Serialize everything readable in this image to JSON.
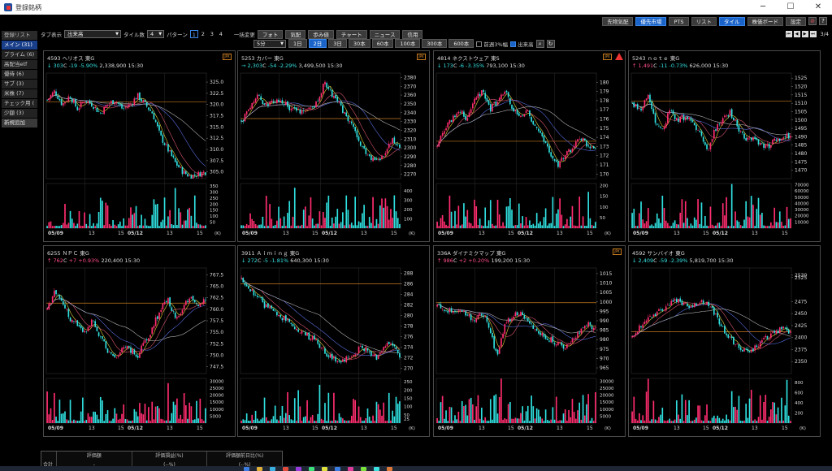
{
  "window": {
    "title": "登録銘柄",
    "min": "─",
    "max": "☐",
    "close": "✕"
  },
  "topbar": {
    "buttons": [
      {
        "label": "先物気配",
        "active": false
      },
      {
        "label": "優先市場",
        "active": true
      },
      {
        "label": "PTS",
        "active": false
      },
      {
        "label": "リスト",
        "active": false
      },
      {
        "label": "タイル",
        "active": true
      },
      {
        "label": "株価ボード",
        "active": false
      },
      {
        "label": "設定",
        "active": false
      }
    ],
    "icons": [
      {
        "name": "pin-icon",
        "glyph": "⊘",
        "color": "#e0505e"
      },
      {
        "name": "help-icon",
        "glyph": "?",
        "color": "#eeeeee"
      }
    ]
  },
  "sidebar": {
    "items": [
      {
        "label": "登録リスト",
        "kind": "header"
      },
      {
        "label": "メイン (31)",
        "kind": "active"
      },
      {
        "label": "プライム (6)",
        "kind": ""
      },
      {
        "label": "高配当etf",
        "kind": ""
      },
      {
        "label": "優待 (6)",
        "kind": ""
      },
      {
        "label": "サブ (3)",
        "kind": ""
      },
      {
        "label": "米株 (7)",
        "kind": ""
      },
      {
        "label": "チェック用 (",
        "kind": ""
      },
      {
        "label": "少額 (3)",
        "kind": ""
      },
      {
        "label": "新規追加",
        "kind": "add"
      }
    ]
  },
  "toolbar": {
    "tab_label": "タブ表示",
    "tab_value": "出来高",
    "tile_label": "タイル数",
    "tile_value": "4",
    "pattern_label": "パターン",
    "patterns": [
      "1",
      "2",
      "3",
      "4"
    ],
    "pattern_active": "1",
    "bulk_label": "一括変更",
    "buttons": [
      "フォト",
      "気配",
      "歩み値",
      "チャート",
      "ニュース",
      "信用"
    ],
    "interval_value": "5分",
    "spans": [
      "1日",
      "2日",
      "3日",
      "30本",
      "60本",
      "100本",
      "300本",
      "600本"
    ],
    "span_active": "2日",
    "opt1": "前週3%幅",
    "opt2": "出来高"
  },
  "pager": {
    "text": "3/4"
  },
  "colors": {
    "up": "#ff2d6f",
    "down": "#30e0e0",
    "ma1": "#e6d23a",
    "ma2": "#d8566f",
    "ma3": "#5a6ee0",
    "ma4": "#b2b2b2",
    "ref": "#c87b1e"
  },
  "tiles": [
    {
      "code": "4593",
      "name": "ヘリオス",
      "market": "東G",
      "arrow": "↓",
      "dir": "dn",
      "price": "303",
      "cflag": "C",
      "change": "-19",
      "pct": "-5.90%",
      "vol": "2,338,900",
      "time": "15:30",
      "badge": "JPX",
      "warn": false,
      "y_ticks": [
        "325.0",
        "322.5",
        "320.0",
        "317.5",
        "315.0",
        "312.5",
        "310.0",
        "307.5",
        "305.0"
      ],
      "v_ticks": [
        "350",
        "300",
        "250",
        "200",
        "150",
        "100",
        "50"
      ],
      "x_labels": [
        "05/09",
        "13",
        "15",
        "05/12",
        "13",
        "15"
      ],
      "vol_unit": "(K)",
      "chart_data": {
        "type": "candlestick",
        "ylim": [
          303.5,
          327
        ],
        "vmax": 370,
        "path": [
          321,
          323,
          320,
          322,
          319,
          321,
          320,
          318,
          320,
          321,
          319,
          320,
          322,
          320,
          318,
          313,
          310,
          307,
          305,
          304,
          304.5,
          305
        ]
      }
    },
    {
      "code": "5253",
      "name": "カバー",
      "market": "東G",
      "arrow": "→",
      "dir": "dn",
      "price": "2,303",
      "cflag": "C",
      "change": "-54",
      "pct": "-2.29%",
      "vol": "3,499,500",
      "time": "15:30",
      "badge": "JPX",
      "warn": false,
      "y_ticks": [
        "2380",
        "2370",
        "2360",
        "2350",
        "2340",
        "2330",
        "2320",
        "2310",
        "2300",
        "2290",
        "2280",
        "2270"
      ],
      "v_ticks": [
        "400",
        "300",
        "200",
        "100"
      ],
      "x_labels": [
        "05/09",
        "13",
        "15",
        "05/12",
        "13",
        "15"
      ],
      "vol_unit": "(K)",
      "chart_data": {
        "type": "candlestick",
        "ylim": [
          2265,
          2385
        ],
        "vmax": 480,
        "path": [
          2330,
          2345,
          2360,
          2352,
          2350,
          2355,
          2348,
          2343,
          2340,
          2347,
          2350,
          2375,
          2360,
          2350,
          2335,
          2320,
          2300,
          2290,
          2285,
          2295,
          2310,
          2303
        ]
      }
    },
    {
      "code": "4814",
      "name": "ネクストウェア",
      "market": "東S",
      "arrow": "↓",
      "dir": "dn",
      "price": "173",
      "cflag": "C",
      "change": "-6",
      "pct": "-3.35%",
      "vol": "793,100",
      "time": "15:30",
      "badge": "JPX",
      "warn": true,
      "y_ticks": [
        "180",
        "179",
        "178",
        "177",
        "176",
        "175",
        "174",
        "173",
        "172",
        "171",
        "170"
      ],
      "v_ticks": [
        "200",
        "150",
        "100",
        "50"
      ],
      "x_labels": [
        "05/09",
        "13",
        "15",
        "05/12",
        "13",
        "15"
      ],
      "vol_unit": "(K)",
      "chart_data": {
        "type": "candlestick",
        "ylim": [
          169.5,
          181
        ],
        "vmax": 210,
        "path": [
          173,
          175,
          176,
          177,
          176,
          178,
          179,
          177,
          178,
          179,
          177,
          176,
          177,
          175,
          174,
          172,
          171,
          172,
          173,
          174,
          173,
          173
        ]
      }
    },
    {
      "code": "5243",
      "name": "ｎｏｔｅ",
      "market": "東G",
      "arrow": "↑",
      "dir": "up",
      "price": "1,491",
      "cflag": "C",
      "change": "-11",
      "pct": "-0.73%",
      "vol": "626,000",
      "time": "15:30",
      "badge": "",
      "warn": false,
      "y_ticks": [
        "1525",
        "1520",
        "1515",
        "1510",
        "1505",
        "1500",
        "1495",
        "1490",
        "1485",
        "1480",
        "1475",
        "1470"
      ],
      "v_ticks": [
        "70000",
        "60000",
        "50000",
        "40000",
        "30000",
        "20000",
        "10000"
      ],
      "x_labels": [
        "05/09",
        "13",
        "15",
        "05/12",
        "13",
        "15"
      ],
      "vol_unit": "",
      "chart_data": {
        "type": "candlestick",
        "ylim": [
          1465,
          1528
        ],
        "vmax": 72000,
        "path": [
          1510,
          1505,
          1515,
          1500,
          1495,
          1505,
          1500,
          1502,
          1498,
          1492,
          1480,
          1495,
          1500,
          1505,
          1495,
          1488,
          1490,
          1486,
          1484,
          1488,
          1490,
          1491
        ]
      }
    },
    {
      "code": "6255",
      "name": "ＮＰＣ",
      "market": "東G",
      "arrow": "↑",
      "dir": "up",
      "price": "762",
      "cflag": "C",
      "change": "+7",
      "pct": "+0.93%",
      "vol": "220,400",
      "time": "15:30",
      "badge": "",
      "warn": false,
      "y_ticks": [
        "767.5",
        "765.0",
        "762.5",
        "760.0",
        "757.5",
        "755.0",
        "752.5",
        "750.0",
        "747.5"
      ],
      "v_ticks": [
        "30000",
        "25000",
        "20000",
        "15000",
        "10000",
        "5000"
      ],
      "x_labels": [
        "05/09",
        "13",
        "15",
        "05/12",
        "13",
        "15"
      ],
      "vol_unit": "",
      "chart_data": {
        "type": "candlestick",
        "ylim": [
          746,
          769
        ],
        "vmax": 32000,
        "path": [
          760,
          764,
          762,
          758,
          757,
          755,
          758,
          754,
          751,
          749,
          752,
          751,
          750,
          753,
          756,
          760,
          762,
          758,
          760,
          763,
          761,
          762
        ]
      }
    },
    {
      "code": "3911",
      "name": "Ａｉｍｉｎｇ",
      "market": "東G",
      "arrow": "↓",
      "dir": "dn",
      "price": "272",
      "cflag": "C",
      "change": "-5",
      "pct": "-1.81%",
      "vol": "640,300",
      "time": "15:30",
      "badge": "",
      "warn": false,
      "y_ticks": [
        "288",
        "286",
        "284",
        "282",
        "280",
        "278",
        "276",
        "274",
        "272",
        "270"
      ],
      "v_ticks": [
        "250",
        "200",
        "150",
        "100",
        "50",
        "25"
      ],
      "x_labels": [
        "05/09",
        "13",
        "15",
        "05/12",
        "13",
        "15"
      ],
      "vol_unit": "(K)",
      "chart_data": {
        "type": "candlestick",
        "ylim": [
          269,
          289
        ],
        "vmax": 270,
        "path": [
          287,
          285,
          284,
          282,
          281,
          280,
          279,
          278,
          277,
          276,
          275,
          273,
          272,
          271,
          272,
          273,
          274,
          273,
          272,
          274,
          275,
          272
        ]
      }
    },
    {
      "code": "336A",
      "name": "ダイナミクマップ",
      "market": "東G",
      "arrow": "↑",
      "dir": "up",
      "price": "986",
      "cflag": "C",
      "change": "+2",
      "pct": "+0.20%",
      "vol": "199,200",
      "time": "15:30",
      "badge": "JPX",
      "warn": false,
      "y_ticks": [
        "1015",
        "1010",
        "1005",
        "1000",
        "995",
        "990",
        "985",
        "980",
        "975",
        "970",
        "965"
      ],
      "v_ticks": [
        "30000",
        "25000",
        "20000",
        "15000",
        "10000",
        "5000"
      ],
      "x_labels": [
        "05/09",
        "13",
        "15",
        "05/12",
        "13",
        "15"
      ],
      "vol_unit": "(K)",
      "chart_data": {
        "type": "candlestick",
        "ylim": [
          962,
          1018
        ],
        "vmax": 32000,
        "path": [
          998,
          996,
          995,
          997,
          993,
          990,
          994,
          985,
          970,
          990,
          992,
          995,
          990,
          985,
          982,
          980,
          978,
          975,
          980,
          985,
          988,
          986
        ]
      }
    },
    {
      "code": "4592",
      "name": "サンバイオ",
      "market": "東G",
      "arrow": "↓",
      "dir": "dn",
      "price": "2,409",
      "cflag": "C",
      "change": "-59",
      "pct": "-2.39%",
      "vol": "5,819,700",
      "time": "15:30",
      "badge": "",
      "warn": false,
      "y_ticks": [
        "2530",
        "2525",
        "2475",
        "2450",
        "2425",
        "2400",
        "2375",
        "2350"
      ],
      "v_ticks": [
        "800",
        "600",
        "400",
        "200"
      ],
      "x_labels": [
        "05/09",
        "13",
        "15",
        "05/12",
        "13",
        "15"
      ],
      "vol_unit": "(K)",
      "chart_data": {
        "type": "candlestick",
        "ylim": [
          2325,
          2545
        ],
        "vmax": 880,
        "path": [
          2400,
          2420,
          2440,
          2450,
          2460,
          2470,
          2480,
          2470,
          2465,
          2475,
          2470,
          2450,
          2420,
          2400,
          2380,
          2370,
          2375,
          2390,
          2400,
          2410,
          2420,
          2409
        ]
      }
    }
  ],
  "bottom": {
    "row_label": "合計",
    "headers": [
      "評価額",
      "評価損益(%)",
      "評価額前日比(%)"
    ],
    "values": [
      "-",
      "(--%)",
      "(--%)"
    ]
  }
}
